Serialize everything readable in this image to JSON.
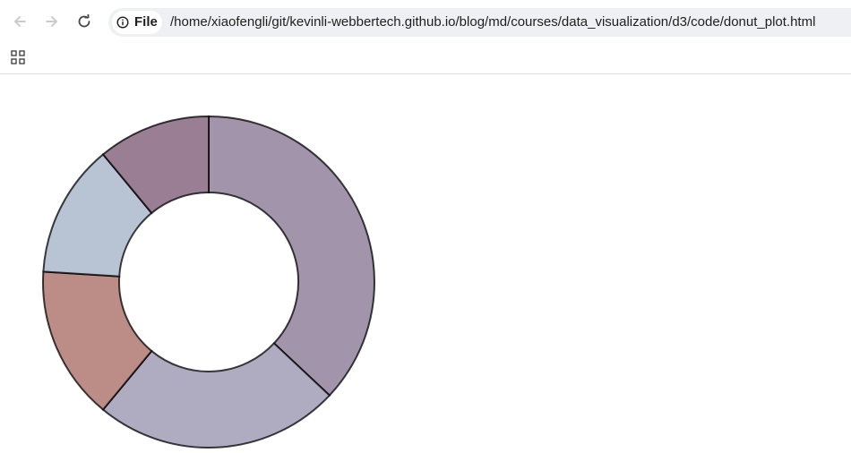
{
  "browser": {
    "nav": {
      "back_icon": "arrow-left-icon",
      "forward_icon": "arrow-right-icon",
      "reload_icon": "reload-icon"
    },
    "site_chip": {
      "icon": "info-icon",
      "label": "File"
    },
    "url": "/home/xiaofengli/git/kevinli-webbertech.github.io/blog/md/courses/data_visualization/d3/code/donut_plot.html",
    "bookmarks_bar": {
      "apps_icon": "apps-grid-icon"
    }
  },
  "chart_data": {
    "type": "donut",
    "slices": [
      {
        "value": 37,
        "color": "#a295ab"
      },
      {
        "value": 24,
        "color": "#afacc2"
      },
      {
        "value": 15,
        "color": "#bc8c86"
      },
      {
        "value": 13,
        "color": "#b8c4d4"
      },
      {
        "value": 11,
        "color": "#9a7e93"
      }
    ],
    "stroke_color": "#000000",
    "labels_shown": false
  }
}
